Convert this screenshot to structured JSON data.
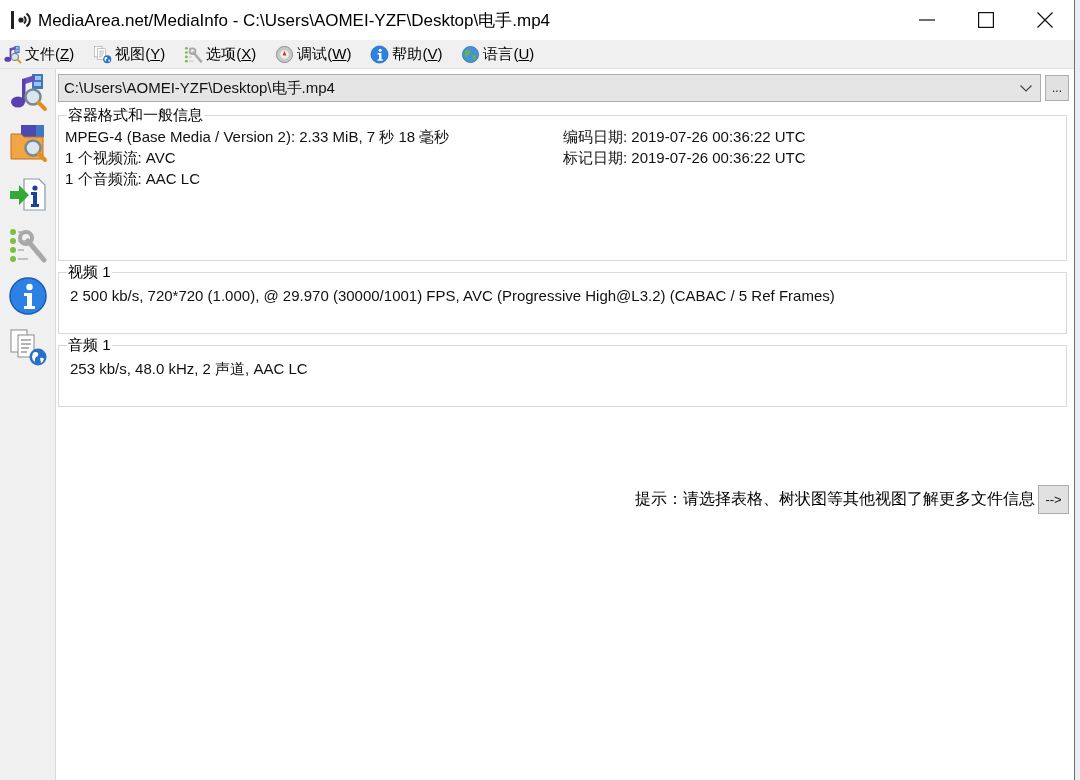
{
  "window": {
    "title": "MediaArea.net/MediaInfo - C:\\Users\\AOMEI-YZF\\Desktop\\电手.mp4"
  },
  "menu_bar": [
    {
      "label_start": "文件(",
      "access_key": "Z",
      "label_end": ")"
    },
    {
      "label_start": "视图(",
      "access_key": "Y",
      "label_end": ")"
    },
    {
      "label_start": "选项(",
      "access_key": "X",
      "label_end": ")"
    },
    {
      "label_start": "调试(",
      "access_key": "W",
      "label_end": ")"
    },
    {
      "label_start": "帮助(",
      "access_key": "V",
      "label_end": ")"
    },
    {
      "label_start": "语言(",
      "access_key": "U",
      "label_end": ")"
    }
  ],
  "file_path": {
    "value": "C:\\Users\\AOMEI-YZF\\Desktop\\电手.mp4"
  },
  "browse_button": {
    "label": "..."
  },
  "sections": [
    {
      "kind": "general",
      "title": "容器格式和一般信息",
      "lines": [
        "MPEG-4 (Base Media / Version 2): 2.33 MiB, 7 秒 18 毫秒",
        "1 个视频流: AVC",
        "1 个音频流: AAC LC"
      ],
      "side_lines": [
        "编码日期: 2019-07-26 00:36:22 UTC",
        "标记日期: 2019-07-26 00:36:22 UTC"
      ]
    },
    {
      "kind": "stream",
      "title": "视频 1",
      "lines": [
        "2 500 kb/s, 720*720 (1.000), @ 29.970 (30000/1001) FPS, AVC (Progressive High@L3.2) (CABAC / 5 Ref Frames)"
      ]
    },
    {
      "kind": "stream",
      "title": "音频 1",
      "lines": [
        "253 kb/s, 48.0 kHz, 2 声道, AAC LC"
      ]
    }
  ],
  "hint": {
    "text": "提示：请选择表格、树状图等其他视图了解更多文件信息",
    "button": "-->"
  }
}
